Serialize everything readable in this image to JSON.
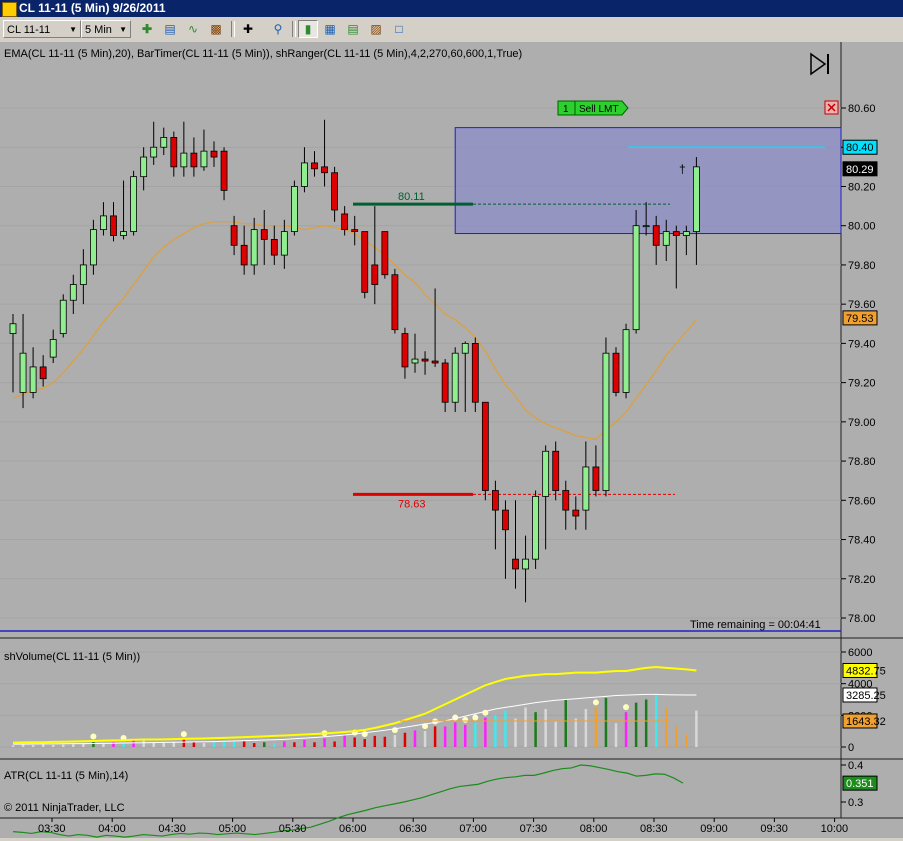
{
  "window": {
    "title": "CL 11-11 (5 Min)  9/26/2011"
  },
  "toolbar": {
    "instrument": "CL 11-11",
    "interval": "5 Min",
    "buttons": [
      "add-icon",
      "data-series-icon",
      "indicators-icon",
      "strategies-icon",
      "crosshair-icon",
      "zoom-icon",
      "bar-chart-icon",
      "properties-icon",
      "drawing-objects-icon",
      "new-window-icon"
    ]
  },
  "colors": {
    "background": "#aeaeae",
    "up_candle": "#90ee90",
    "down_candle": "#dd0000",
    "range_box": "#8c8cc8",
    "ema": "#dca040",
    "sell_line": "#00e0ff",
    "volume_upper": "#ffff00",
    "volume_mid": "#ffffff",
    "volume_lower": "#f0a030",
    "atr": "#1c8c1c"
  },
  "price_panel": {
    "label": "EMA(CL 11-11 (5 Min),20), BarTimer(CL 11-11 (5 Min)), shRanger(CL 11-11 (5 Min),4,2,270,60,600,1,True)",
    "axis_ticks": [
      "80.60",
      "80.40",
      "80.20",
      "80.00",
      "79.80",
      "79.60",
      "79.40",
      "79.20",
      "79.00",
      "78.80",
      "78.60",
      "78.40",
      "78.20",
      "78.00"
    ],
    "sell_order": {
      "qty": "1",
      "label": "Sell LMT",
      "price": "80.40"
    },
    "last_price": "80.29",
    "ema_value": "79.53",
    "range_high_label": "80.11",
    "range_low_label": "78.63",
    "time_remaining": "Time remaining = 00:04:41"
  },
  "volume_panel": {
    "label": "shVolume(CL 11-11 (5 Min))",
    "axis_ticks": [
      "6000",
      "4000",
      "2000",
      "0"
    ],
    "marker_upper": "4832.75",
    "marker_mid": "3285.25",
    "marker_lower": "1643.32"
  },
  "atr_panel": {
    "label": "ATR(CL 11-11 (5 Min),14)",
    "axis_ticks": [
      "0.4",
      "0.3"
    ],
    "marker": "0.351",
    "copyright": "© 2011 NinjaTrader, LLC"
  },
  "time_axis": [
    "03:30",
    "04:00",
    "04:30",
    "05:00",
    "05:30",
    "06:00",
    "06:30",
    "07:00",
    "07:30",
    "08:00",
    "08:30",
    "09:00",
    "09:30",
    "10:00"
  ],
  "chart_data": [
    {
      "type": "candlestick",
      "x_start": "03:15",
      "interval_minutes": 5,
      "ylim": [
        77.98,
        80.68
      ],
      "candles": [
        [
          79.45,
          79.5,
          79.55,
          79.15
        ],
        [
          79.15,
          79.35,
          79.55,
          79.07
        ],
        [
          79.15,
          79.28,
          79.38,
          79.12
        ],
        [
          79.28,
          79.22,
          79.34,
          79.18
        ],
        [
          79.33,
          79.42,
          79.47,
          79.3
        ],
        [
          79.45,
          79.62,
          79.65,
          79.43
        ],
        [
          79.62,
          79.7,
          79.75,
          79.55
        ],
        [
          79.7,
          79.8,
          79.88,
          79.6
        ],
        [
          79.8,
          79.98,
          80.03,
          79.75
        ],
        [
          79.98,
          80.05,
          80.12,
          79.95
        ],
        [
          80.05,
          79.95,
          80.12,
          79.92
        ],
        [
          79.95,
          79.97,
          80.23,
          79.93
        ],
        [
          79.97,
          80.25,
          80.28,
          79.95
        ],
        [
          80.25,
          80.35,
          80.4,
          80.18
        ],
        [
          80.35,
          80.4,
          80.53,
          80.31
        ],
        [
          80.4,
          80.45,
          80.5,
          80.36
        ],
        [
          80.45,
          80.3,
          80.48,
          80.25
        ],
        [
          80.3,
          80.37,
          80.53,
          80.25
        ],
        [
          80.37,
          80.3,
          80.45,
          80.25
        ],
        [
          80.3,
          80.38,
          80.49,
          80.28
        ],
        [
          80.38,
          80.35,
          80.43,
          80.3
        ],
        [
          80.38,
          80.18,
          80.4,
          80.13
        ],
        [
          80.0,
          79.9,
          80.05,
          79.85
        ],
        [
          79.9,
          79.8,
          80.0,
          79.75
        ],
        [
          79.8,
          79.98,
          80.04,
          79.75
        ],
        [
          79.98,
          79.93,
          80.08,
          79.8
        ],
        [
          79.93,
          79.85,
          80.0,
          79.8
        ],
        [
          79.85,
          79.97,
          80.03,
          79.78
        ],
        [
          79.97,
          80.2,
          80.23,
          79.95
        ],
        [
          80.2,
          80.32,
          80.4,
          80.17
        ],
        [
          80.32,
          80.29,
          80.38,
          80.25
        ],
        [
          80.3,
          80.27,
          80.54,
          80.2
        ],
        [
          80.27,
          80.08,
          80.3,
          80.02
        ],
        [
          80.06,
          79.98,
          80.1,
          79.95
        ],
        [
          79.98,
          79.97,
          80.05,
          79.9
        ],
        [
          79.97,
          79.66,
          79.97,
          79.63
        ],
        [
          79.8,
          79.7,
          80.1,
          79.6
        ],
        [
          79.97,
          79.75,
          79.97,
          79.73
        ],
        [
          79.75,
          79.47,
          79.78,
          79.45
        ],
        [
          79.45,
          79.28,
          79.48,
          79.22
        ],
        [
          79.3,
          79.32,
          79.45,
          79.25
        ],
        [
          79.32,
          79.31,
          79.36,
          79.24
        ],
        [
          79.31,
          79.3,
          79.68,
          79.28
        ],
        [
          79.3,
          79.1,
          79.32,
          79.05
        ],
        [
          79.1,
          79.35,
          79.38,
          79.05
        ],
        [
          79.35,
          79.4,
          79.41,
          79.05
        ],
        [
          79.4,
          79.1,
          79.43,
          79.05
        ],
        [
          79.1,
          78.65,
          79.0,
          78.6
        ],
        [
          78.65,
          78.55,
          78.7,
          78.35
        ],
        [
          78.55,
          78.45,
          78.6,
          78.2
        ],
        [
          78.3,
          78.25,
          78.6,
          78.15
        ],
        [
          78.25,
          78.3,
          78.42,
          78.08
        ],
        [
          78.3,
          78.62,
          78.65,
          78.25
        ],
        [
          78.62,
          78.85,
          78.88,
          78.35
        ],
        [
          78.85,
          78.65,
          78.9,
          78.6
        ],
        [
          78.65,
          78.55,
          78.7,
          78.45
        ],
        [
          78.55,
          78.52,
          78.62,
          78.45
        ],
        [
          78.55,
          78.77,
          78.9,
          78.45
        ],
        [
          78.77,
          78.65,
          78.88,
          78.62
        ],
        [
          78.65,
          79.35,
          79.43,
          78.62
        ],
        [
          79.35,
          79.15,
          79.38,
          79.13
        ],
        [
          79.15,
          79.47,
          79.5,
          79.12
        ],
        [
          79.47,
          80.0,
          80.08,
          79.45
        ],
        [
          80.0,
          80.0,
          80.12,
          79.95
        ],
        [
          80.0,
          79.9,
          80.05,
          79.8
        ],
        [
          79.9,
          79.97,
          80.03,
          79.82
        ],
        [
          79.97,
          79.95,
          80.0,
          79.68
        ],
        [
          79.95,
          79.97,
          80.0,
          79.85
        ],
        [
          79.97,
          80.3,
          80.35,
          79.8
        ]
      ],
      "ema": [
        79.12,
        79.14,
        79.16,
        79.17,
        79.2,
        79.25,
        79.31,
        79.37,
        79.44,
        79.51,
        79.57,
        79.63,
        79.7,
        79.77,
        79.84,
        79.89,
        79.93,
        79.96,
        79.99,
        80.01,
        80.02,
        80.02,
        80.02,
        80.01,
        80.01,
        80.0,
        80.0,
        80.0,
        79.99,
        79.98,
        79.99,
        80.0,
        79.99,
        79.98,
        79.96,
        79.92,
        79.89,
        79.85,
        79.8,
        79.75,
        79.71,
        79.65,
        79.6,
        79.55,
        79.52,
        79.48,
        79.43,
        79.36,
        79.27,
        79.19,
        79.13,
        79.06,
        79.02,
        78.99,
        78.97,
        78.95,
        78.93,
        78.92,
        78.91,
        78.96,
        79.0,
        79.05,
        79.12,
        79.19,
        79.26,
        79.34,
        79.4,
        79.46,
        79.52
      ],
      "range_box": {
        "high": 80.5,
        "low": 79.96,
        "start_index": 44
      },
      "range_high": 80.11,
      "range_low": 78.63,
      "sell_limit": 80.4
    },
    {
      "type": "bar",
      "ylim": [
        0,
        6300
      ],
      "volumes": [
        100,
        150,
        120,
        200,
        130,
        150,
        180,
        200,
        350,
        200,
        300,
        250,
        500,
        400,
        300,
        250,
        300,
        500,
        300,
        250,
        300,
        400,
        350,
        350,
        250,
        300,
        250,
        350,
        300,
        450,
        300,
        550,
        350,
        750,
        600,
        500,
        700,
        650,
        750,
        900,
        1050,
        1000,
        1300,
        1300,
        1550,
        1400,
        1550,
        1850,
        2000,
        2300,
        1800,
        2500,
        2200,
        2400,
        1600,
        3000,
        1800,
        2400,
        2500,
        3100,
        1500,
        2200,
        2800,
        3000,
        3300,
        2500,
        1300,
        800,
        2300
      ],
      "volume_colors": [
        "w",
        "w",
        "w",
        "w",
        "w",
        "w",
        "w",
        "w",
        "g",
        "w",
        "m",
        "c",
        "m",
        "w",
        "w",
        "w",
        "w",
        "r",
        "r",
        "w",
        "c",
        "c",
        "c",
        "r",
        "r",
        "g",
        "c",
        "m",
        "r",
        "m",
        "r",
        "m",
        "r",
        "m",
        "r",
        "r",
        "r",
        "r",
        "w",
        "r",
        "m",
        "w",
        "r",
        "m",
        "m",
        "m",
        "c",
        "m",
        "c",
        "c",
        "w",
        "w",
        "g",
        "w",
        "w",
        "g",
        "w",
        "w",
        "o",
        "g",
        "w",
        "m",
        "g",
        "g",
        "c",
        "o",
        "o",
        "o",
        "w"
      ],
      "upper_band": [
        280,
        290,
        300,
        300,
        320,
        330,
        350,
        360,
        380,
        400,
        420,
        430,
        460,
        470,
        470,
        480,
        500,
        520,
        530,
        540,
        560,
        580,
        600,
        620,
        650,
        670,
        700,
        730,
        760,
        790,
        820,
        850,
        900,
        950,
        1000,
        1080,
        1200,
        1350,
        1500,
        1700,
        1900,
        2100,
        2400,
        2700,
        3000,
        3300,
        3600,
        3900,
        4100,
        4300,
        4400,
        4500,
        4550,
        4600,
        4600,
        4650,
        4700,
        4700,
        4700,
        4750,
        4800,
        4800,
        4900,
        5000,
        5050,
        5000,
        4950,
        4900,
        4832.75
      ],
      "mid_band": [
        180,
        185,
        190,
        195,
        200,
        205,
        210,
        215,
        220,
        230,
        240,
        250,
        260,
        270,
        280,
        290,
        300,
        310,
        320,
        330,
        340,
        360,
        380,
        400,
        420,
        440,
        460,
        480,
        520,
        560,
        600,
        650,
        700,
        760,
        820,
        900,
        980,
        1060,
        1150,
        1250,
        1350,
        1450,
        1550,
        1650,
        1800,
        1950,
        2100,
        2250,
        2400,
        2500,
        2600,
        2700,
        2800,
        2880,
        2950,
        3000,
        3050,
        3100,
        3150,
        3200,
        3250,
        3280,
        3300,
        3320,
        3320,
        3300,
        3290,
        3285,
        3285.25
      ],
      "lower_band": [
        1643.32
      ]
    },
    {
      "type": "line",
      "ylim": [
        0.17,
        0.42
      ],
      "values": [
        0.22,
        0.218,
        0.215,
        0.22,
        0.218,
        0.212,
        0.208,
        0.212,
        0.21,
        0.205,
        0.21,
        0.208,
        0.205,
        0.208,
        0.212,
        0.21,
        0.208,
        0.212,
        0.215,
        0.213,
        0.216,
        0.215,
        0.212,
        0.214,
        0.216,
        0.214,
        0.212,
        0.215,
        0.218,
        0.222,
        0.224,
        0.228,
        0.232,
        0.24,
        0.248,
        0.258,
        0.266,
        0.272,
        0.278,
        0.285,
        0.29,
        0.295,
        0.3,
        0.306,
        0.312,
        0.32,
        0.328,
        0.336,
        0.342,
        0.345,
        0.348,
        0.356,
        0.362,
        0.366,
        0.368,
        0.372,
        0.372,
        0.378,
        0.385,
        0.39,
        0.392,
        0.4,
        0.398,
        0.393,
        0.388,
        0.382,
        0.378,
        0.37,
        0.372,
        0.376,
        0.375,
        0.365,
        0.351
      ]
    }
  ]
}
